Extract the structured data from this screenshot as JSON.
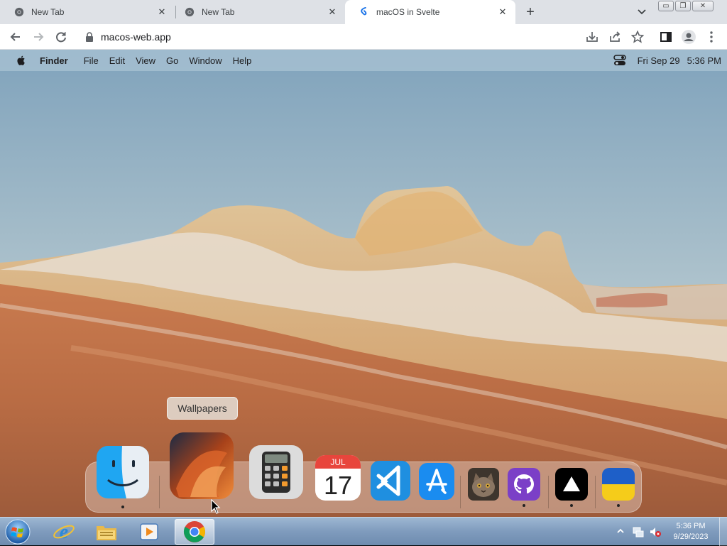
{
  "browser": {
    "tabs": [
      {
        "title": "New Tab",
        "close": "✕",
        "active": false
      },
      {
        "title": "New Tab",
        "close": "✕",
        "active": false
      },
      {
        "title": "macOS in Svelte",
        "close": "✕",
        "active": true
      }
    ],
    "new_tab_label": "+",
    "window_controls": {
      "minimize": "▭",
      "maximize": "❐",
      "close": "✕"
    },
    "address": "macos-web.app",
    "toolbar_icons": [
      "back-icon",
      "forward-icon",
      "reload-icon",
      "lock-icon",
      "install-icon",
      "share-icon",
      "bookmark-star-icon",
      "side-panel-icon",
      "profile-icon",
      "menu-kebab-icon"
    ]
  },
  "mac": {
    "menubar": {
      "app_name": "Finder",
      "items": [
        "File",
        "Edit",
        "View",
        "Go",
        "Window",
        "Help"
      ],
      "date": "Fri Sep 29",
      "time": "5:36 PM"
    },
    "tooltip": "Wallpapers",
    "dock": {
      "calendar_month": "JUL",
      "calendar_day": "17",
      "items": [
        {
          "name": "Finder",
          "icon": "finder-icon",
          "running": true
        },
        {
          "name": "Wallpapers",
          "icon": "wallpapers-icon",
          "running": false
        },
        {
          "name": "Calculator",
          "icon": "calculator-icon",
          "running": false
        },
        {
          "name": "Calendar",
          "icon": "calendar-icon",
          "running": false
        },
        {
          "name": "VS Code",
          "icon": "vscode-icon",
          "running": false
        },
        {
          "name": "App Store",
          "icon": "app-store-icon",
          "running": false
        },
        {
          "name": "Purrfect",
          "icon": "cat-photo-icon",
          "running": false
        },
        {
          "name": "GitHub",
          "icon": "github-icon",
          "running": true
        },
        {
          "name": "Vercel",
          "icon": "vercel-icon",
          "running": true
        },
        {
          "name": "Ukraine",
          "icon": "ukraine-flag-icon",
          "running": true
        }
      ]
    }
  },
  "taskbar": {
    "clock_time": "5:36 PM",
    "clock_date": "9/29/2023",
    "apps": [
      "ie-icon",
      "explorer-icon",
      "media-player-icon",
      "chrome-icon"
    ]
  },
  "colors": {
    "tabstrip": "#dee1e6",
    "vscode_blue": "#1f8fe0",
    "appstore_blue": "#1a8cf0",
    "github_purple": "#7b3fc7",
    "ukraine_blue": "#1e5fc8",
    "ukraine_yellow": "#f5cc1a",
    "calendar_red": "#e8453c"
  }
}
